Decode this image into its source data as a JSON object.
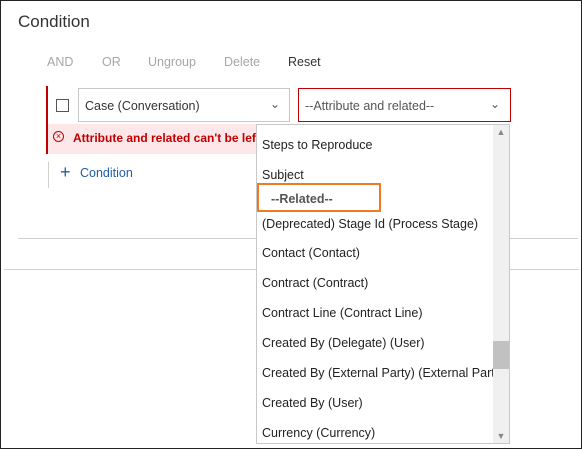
{
  "dialog": {
    "title": "Condition"
  },
  "toolbar": {
    "and": "AND",
    "or": "OR",
    "ungroup": "Ungroup",
    "delete": "Delete",
    "reset": "Reset"
  },
  "condition": {
    "entity_value": "Case (Conversation)",
    "attribute_placeholder": "--Attribute and related--",
    "error_text": "Attribute and related can't be left blank",
    "add_condition_label": "Condition"
  },
  "dropdown": {
    "options": [
      "Steps to Reproduce",
      "Subject",
      "--Related--",
      "(Deprecated) Stage Id (Process Stage)",
      "Contact (Contact)",
      "Contract (Contract)",
      "Contract Line (Contract Line)",
      "Created By (Delegate) (User)",
      "Created By (External Party) (External Party)",
      "Created By (User)",
      "Currency (Currency)"
    ]
  },
  "icons": {
    "error": "error-circle-icon",
    "add": "plus-icon",
    "chevron": "chevron-down-icon"
  },
  "colors": {
    "error": "#c00000",
    "link": "#1f5fa8",
    "highlight": "#ee7a21"
  }
}
